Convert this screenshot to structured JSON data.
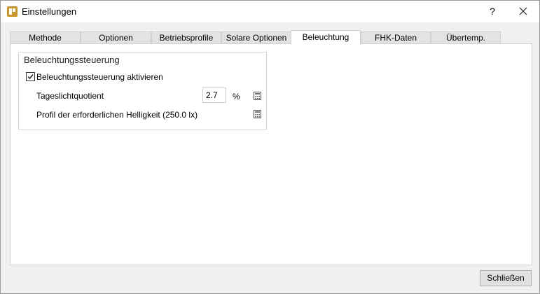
{
  "window": {
    "title": "Einstellungen",
    "help_label": "?"
  },
  "tabs": [
    {
      "label": "Methode"
    },
    {
      "label": "Optionen"
    },
    {
      "label": "Betriebsprofile"
    },
    {
      "label": "Solare Optionen"
    },
    {
      "label": "Beleuchtung",
      "active": true
    },
    {
      "label": "FHK-Daten"
    },
    {
      "label": "Übertemp."
    }
  ],
  "lighting": {
    "group_title": "Beleuchtungssteuerung",
    "enable_label": "Beleuchtungssteuerung aktivieren",
    "enable_checked": true,
    "daylight_label": "Tageslichtquotient",
    "daylight_value": "2.7",
    "daylight_unit": "%",
    "profile_label": "Profil der erforderlichen Helligkeit (250.0 lx)"
  },
  "footer": {
    "close_label": "Schließen"
  },
  "icons": {
    "app": "app-logo-icon",
    "close": "close-icon",
    "calc": "calculator-icon",
    "check": "checkmark-icon"
  }
}
